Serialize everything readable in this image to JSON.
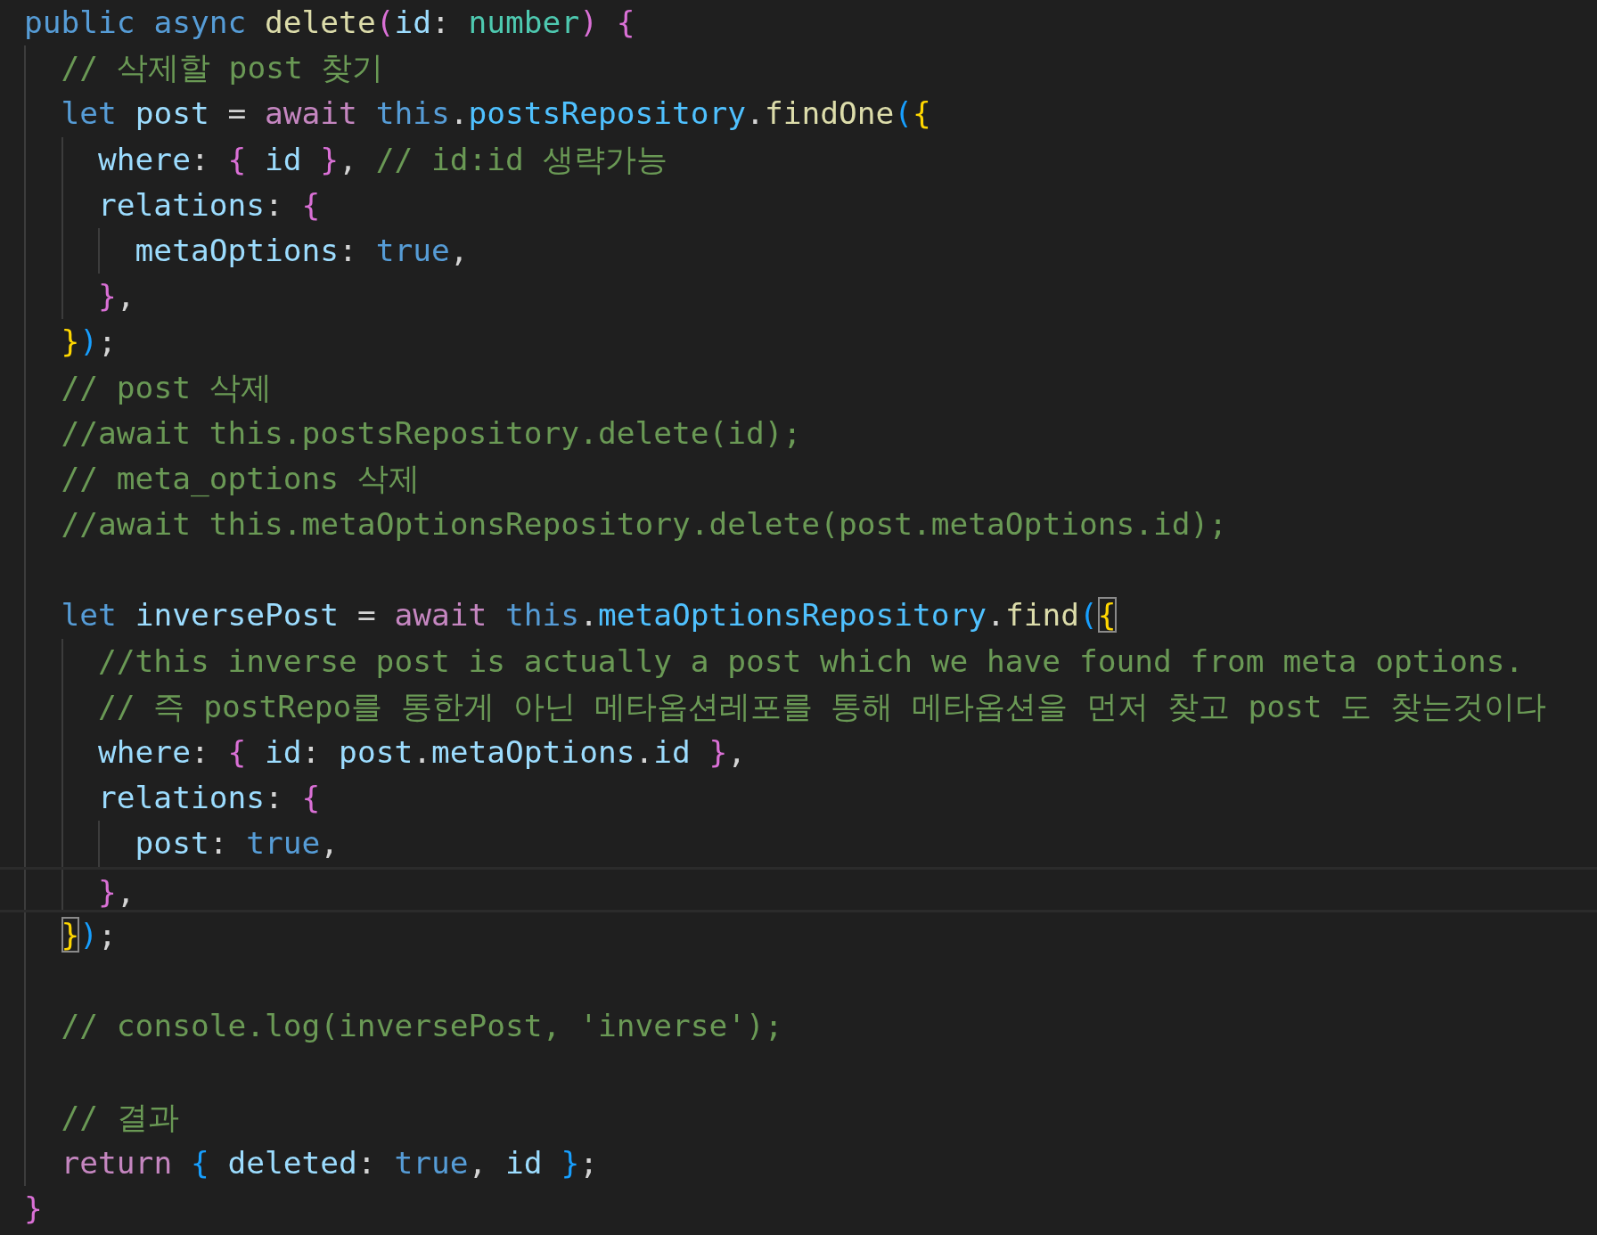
{
  "lines": [
    {
      "current": false,
      "tokens": [
        {
          "text": "public ",
          "kind": "keyword"
        },
        {
          "text": "async ",
          "kind": "keyword"
        },
        {
          "text": "delete",
          "kind": "function"
        },
        {
          "text": "(",
          "kind": "bracket2"
        },
        {
          "text": "id",
          "kind": "variable"
        },
        {
          "text": ": ",
          "kind": "punct"
        },
        {
          "text": "number",
          "kind": "type"
        },
        {
          "text": ") ",
          "kind": "bracket2"
        },
        {
          "text": "{",
          "kind": "bracket2"
        }
      ],
      "children": [
        {
          "current": false,
          "tokens": [
            {
              "text": "// 삭제할 post 찾기",
              "kind": "comment"
            }
          ]
        },
        {
          "current": false,
          "tokens": [
            {
              "text": "let ",
              "kind": "keyword"
            },
            {
              "text": "post",
              "kind": "variable"
            },
            {
              "text": " = ",
              "kind": "punct"
            },
            {
              "text": "await ",
              "kind": "control"
            },
            {
              "text": "this",
              "kind": "keyword"
            },
            {
              "text": ".",
              "kind": "punct"
            },
            {
              "text": "postsRepository",
              "kind": "property"
            },
            {
              "text": ".",
              "kind": "punct"
            },
            {
              "text": "findOne",
              "kind": "function"
            },
            {
              "text": "(",
              "kind": "bracket3"
            },
            {
              "text": "{",
              "kind": "bracket1"
            }
          ],
          "children": [
            {
              "current": false,
              "tokens": [
                {
                  "text": "where",
                  "kind": "variable"
                },
                {
                  "text": ": ",
                  "kind": "punct"
                },
                {
                  "text": "{ ",
                  "kind": "bracket2"
                },
                {
                  "text": "id ",
                  "kind": "variable"
                },
                {
                  "text": "}",
                  "kind": "bracket2"
                },
                {
                  "text": ", ",
                  "kind": "punct"
                },
                {
                  "text": "// id:id 생략가능",
                  "kind": "comment"
                }
              ]
            },
            {
              "current": false,
              "tokens": [
                {
                  "text": "relations",
                  "kind": "variable"
                },
                {
                  "text": ": ",
                  "kind": "punct"
                },
                {
                  "text": "{",
                  "kind": "bracket2"
                }
              ],
              "children": [
                {
                  "current": false,
                  "tokens": [
                    {
                      "text": "metaOptions",
                      "kind": "variable"
                    },
                    {
                      "text": ": ",
                      "kind": "punct"
                    },
                    {
                      "text": "true",
                      "kind": "keyword"
                    },
                    {
                      "text": ",",
                      "kind": "punct"
                    }
                  ]
                }
              ]
            },
            {
              "current": false,
              "tokens": [
                {
                  "text": "}",
                  "kind": "bracket2"
                },
                {
                  "text": ",",
                  "kind": "punct"
                }
              ]
            }
          ]
        },
        {
          "current": false,
          "tokens": [
            {
              "text": "}",
              "kind": "bracket1"
            },
            {
              "text": ")",
              "kind": "bracket3"
            },
            {
              "text": ";",
              "kind": "punct"
            }
          ]
        },
        {
          "current": false,
          "tokens": [
            {
              "text": "// post 삭제",
              "kind": "comment"
            }
          ]
        },
        {
          "current": false,
          "tokens": [
            {
              "text": "//await this.postsRepository.delete(id);",
              "kind": "comment"
            }
          ]
        },
        {
          "current": false,
          "tokens": [
            {
              "text": "// meta_options 삭제",
              "kind": "comment"
            }
          ]
        },
        {
          "current": false,
          "tokens": [
            {
              "text": "//await this.metaOptionsRepository.delete(post.metaOptions.id);",
              "kind": "comment"
            }
          ]
        },
        {
          "current": false
        },
        {
          "current": false,
          "tokens": [
            {
              "text": "let ",
              "kind": "keyword"
            },
            {
              "text": "inversePost",
              "kind": "variable"
            },
            {
              "text": " = ",
              "kind": "punct"
            },
            {
              "text": "await ",
              "kind": "control"
            },
            {
              "text": "this",
              "kind": "keyword"
            },
            {
              "text": ".",
              "kind": "punct"
            },
            {
              "text": "metaOptionsRepository",
              "kind": "property"
            },
            {
              "text": ".",
              "kind": "punct"
            },
            {
              "text": "find",
              "kind": "function"
            },
            {
              "text": "(",
              "kind": "bracket3"
            },
            {
              "text": "{",
              "kind": "bracket1-match"
            }
          ],
          "children": [
            {
              "current": false,
              "tokens": [
                {
                  "text": "//this inverse post is actually a post which we have found from meta options.",
                  "kind": "comment"
                }
              ]
            },
            {
              "current": false,
              "tokens": [
                {
                  "text": "// 즉 postRepo를 통한게 아닌 메타옵션레포를 통해 메타옵션을 먼저 찾고 post 도 찾는것이다",
                  "kind": "comment"
                }
              ]
            },
            {
              "current": false,
              "tokens": [
                {
                  "text": "where",
                  "kind": "variable"
                },
                {
                  "text": ": ",
                  "kind": "punct"
                },
                {
                  "text": "{ ",
                  "kind": "bracket2"
                },
                {
                  "text": "id",
                  "kind": "variable"
                },
                {
                  "text": ": ",
                  "kind": "punct"
                },
                {
                  "text": "post",
                  "kind": "variable"
                },
                {
                  "text": ".",
                  "kind": "punct"
                },
                {
                  "text": "metaOptions",
                  "kind": "variable"
                },
                {
                  "text": ".",
                  "kind": "punct"
                },
                {
                  "text": "id ",
                  "kind": "variable"
                },
                {
                  "text": "}",
                  "kind": "bracket2"
                },
                {
                  "text": ",",
                  "kind": "punct"
                }
              ]
            },
            {
              "current": false,
              "tokens": [
                {
                  "text": "relations",
                  "kind": "variable"
                },
                {
                  "text": ": ",
                  "kind": "punct"
                },
                {
                  "text": "{",
                  "kind": "bracket2"
                }
              ],
              "children": [
                {
                  "current": false,
                  "tokens": [
                    {
                      "text": "post",
                      "kind": "variable"
                    },
                    {
                      "text": ": ",
                      "kind": "punct"
                    },
                    {
                      "text": "true",
                      "kind": "keyword"
                    },
                    {
                      "text": ",",
                      "kind": "punct"
                    }
                  ]
                }
              ]
            },
            {
              "current": true,
              "tokens": [
                {
                  "text": "}",
                  "kind": "bracket2"
                },
                {
                  "text": ",",
                  "kind": "punct"
                }
              ]
            }
          ]
        },
        {
          "current": false,
          "tokens": [
            {
              "text": "}",
              "kind": "bracket1-match"
            },
            {
              "text": ")",
              "kind": "bracket3"
            },
            {
              "text": ";",
              "kind": "punct"
            }
          ]
        },
        {
          "current": false
        },
        {
          "current": false,
          "tokens": [
            {
              "text": "// console.log(inversePost, 'inverse');",
              "kind": "comment"
            }
          ]
        },
        {
          "current": false
        },
        {
          "current": false,
          "tokens": [
            {
              "text": "// 결과",
              "kind": "comment"
            }
          ]
        },
        {
          "current": false,
          "tokens": [
            {
              "text": "return ",
              "kind": "control"
            },
            {
              "text": "{ ",
              "kind": "bracket3"
            },
            {
              "text": "deleted",
              "kind": "variable"
            },
            {
              "text": ": ",
              "kind": "punct"
            },
            {
              "text": "true",
              "kind": "keyword"
            },
            {
              "text": ", ",
              "kind": "punct"
            },
            {
              "text": "id ",
              "kind": "variable"
            },
            {
              "text": "}",
              "kind": "bracket3"
            },
            {
              "text": ";",
              "kind": "punct"
            }
          ]
        }
      ]
    },
    {
      "current": false,
      "tokens": [
        {
          "text": "}",
          "kind": "bracket2"
        }
      ]
    }
  ]
}
